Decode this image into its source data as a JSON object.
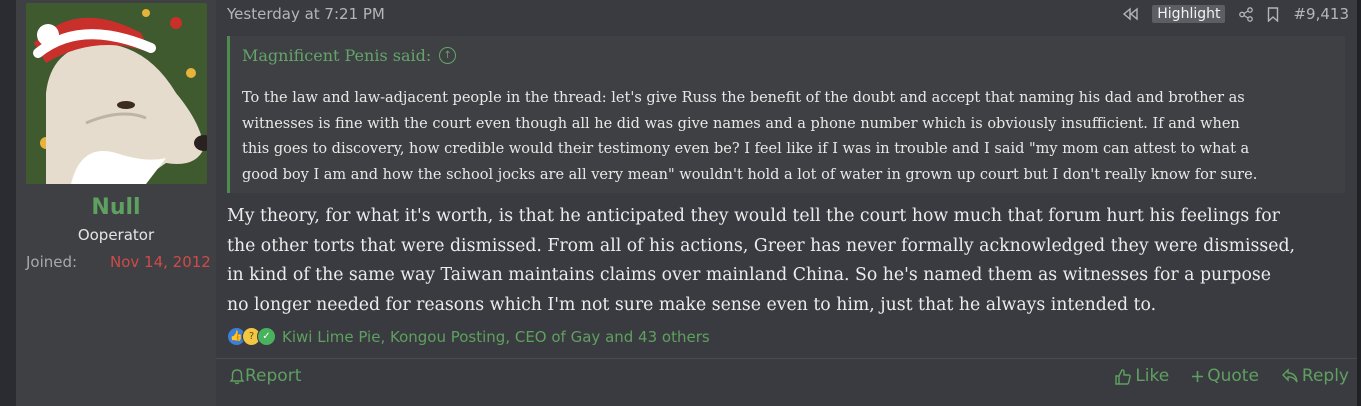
{
  "user": {
    "name": "Null",
    "title": "Ooperator",
    "joined_label": "Joined:",
    "joined_date": "Nov 14, 2012"
  },
  "post": {
    "date": "Yesterday at 7:21 PM",
    "highlight_label": "Highlight",
    "post_number": "#9,413",
    "quote": {
      "author": "Magnificent Penis said:",
      "lines": [
        "To the law and law-adjacent people in the thread: let's give Russ the benefit of the doubt and accept that naming his dad and brother as",
        "witnesses is fine with the court even though all he did was give names and a phone number which is obviously insufficient. If and when",
        "this goes to discovery, how credible would their testimony even be? I feel like if I was in trouble and I said \"my mom can attest to what a",
        "good boy I am and how the school jocks are all very mean\" wouldn't hold a lot of water in grown up court but I don't really know for sure."
      ]
    },
    "body_lines": [
      "My theory, for what it's worth, is that he anticipated they would tell the court how much that forum hurt his feelings for",
      "the other torts that were dismissed. From all of his actions, Greer has never formally acknowledged they were dismissed,",
      "in kind of the same way Taiwan maintains claims over mainland China. So he's named them as witnesses for a purpose",
      "no longer needed for reasons which I'm not sure make sense even to him, just that he always intended to."
    ],
    "reactions_text": "Kiwi Lime Pie, Kongou Posting, CEO of Gay and 43 others"
  },
  "footer": {
    "report": "Report",
    "like": "Like",
    "quote": "Quote",
    "reply": "Reply"
  },
  "colors": {
    "accent_green": "#5ea05f",
    "joined_red": "#d04a4a",
    "background": "#3a3b40"
  }
}
